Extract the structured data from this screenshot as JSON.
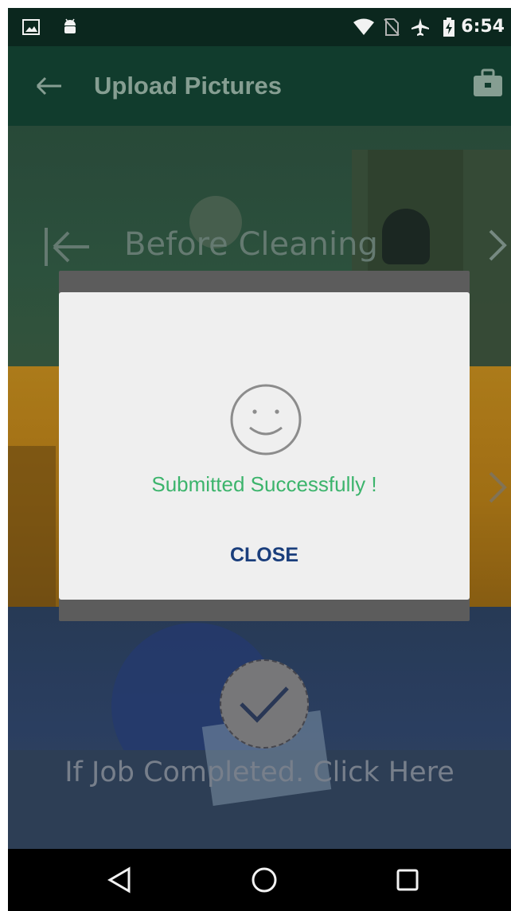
{
  "status_bar": {
    "time": "6:54",
    "icons": [
      "image-icon",
      "android-icon",
      "wifi-icon",
      "no-sim-icon",
      "airplane-icon",
      "battery-charging-icon"
    ]
  },
  "app_bar": {
    "title": "Upload Pictures",
    "back_icon": "arrow-left-icon",
    "action_icon": "briefcase-icon"
  },
  "sections": {
    "before": {
      "label": "Before Cleaning"
    }
  },
  "job_completed": {
    "label": "If Job Completed. Click Here"
  },
  "dialog": {
    "message": "Submitted Successfully !",
    "close_label": "CLOSE",
    "accent_color": "#3cb46c",
    "button_color": "#1a3e7c"
  },
  "nav_bar": {
    "icons": [
      "back-triangle-icon",
      "home-circle-icon",
      "recents-square-icon"
    ]
  }
}
